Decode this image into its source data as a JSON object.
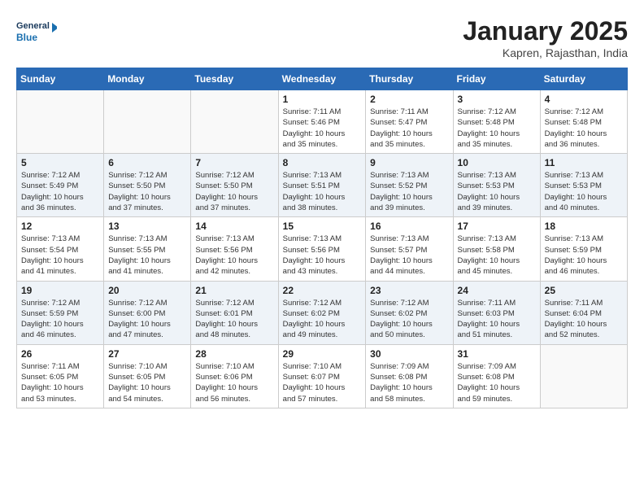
{
  "header": {
    "logo_line1": "General",
    "logo_line2": "Blue",
    "month": "January 2025",
    "location": "Kapren, Rajasthan, India"
  },
  "days_of_week": [
    "Sunday",
    "Monday",
    "Tuesday",
    "Wednesday",
    "Thursday",
    "Friday",
    "Saturday"
  ],
  "weeks": [
    [
      {
        "day": "",
        "info": ""
      },
      {
        "day": "",
        "info": ""
      },
      {
        "day": "",
        "info": ""
      },
      {
        "day": "1",
        "info": "Sunrise: 7:11 AM\nSunset: 5:46 PM\nDaylight: 10 hours\nand 35 minutes."
      },
      {
        "day": "2",
        "info": "Sunrise: 7:11 AM\nSunset: 5:47 PM\nDaylight: 10 hours\nand 35 minutes."
      },
      {
        "day": "3",
        "info": "Sunrise: 7:12 AM\nSunset: 5:48 PM\nDaylight: 10 hours\nand 35 minutes."
      },
      {
        "day": "4",
        "info": "Sunrise: 7:12 AM\nSunset: 5:48 PM\nDaylight: 10 hours\nand 36 minutes."
      }
    ],
    [
      {
        "day": "5",
        "info": "Sunrise: 7:12 AM\nSunset: 5:49 PM\nDaylight: 10 hours\nand 36 minutes."
      },
      {
        "day": "6",
        "info": "Sunrise: 7:12 AM\nSunset: 5:50 PM\nDaylight: 10 hours\nand 37 minutes."
      },
      {
        "day": "7",
        "info": "Sunrise: 7:12 AM\nSunset: 5:50 PM\nDaylight: 10 hours\nand 37 minutes."
      },
      {
        "day": "8",
        "info": "Sunrise: 7:13 AM\nSunset: 5:51 PM\nDaylight: 10 hours\nand 38 minutes."
      },
      {
        "day": "9",
        "info": "Sunrise: 7:13 AM\nSunset: 5:52 PM\nDaylight: 10 hours\nand 39 minutes."
      },
      {
        "day": "10",
        "info": "Sunrise: 7:13 AM\nSunset: 5:53 PM\nDaylight: 10 hours\nand 39 minutes."
      },
      {
        "day": "11",
        "info": "Sunrise: 7:13 AM\nSunset: 5:53 PM\nDaylight: 10 hours\nand 40 minutes."
      }
    ],
    [
      {
        "day": "12",
        "info": "Sunrise: 7:13 AM\nSunset: 5:54 PM\nDaylight: 10 hours\nand 41 minutes."
      },
      {
        "day": "13",
        "info": "Sunrise: 7:13 AM\nSunset: 5:55 PM\nDaylight: 10 hours\nand 41 minutes."
      },
      {
        "day": "14",
        "info": "Sunrise: 7:13 AM\nSunset: 5:56 PM\nDaylight: 10 hours\nand 42 minutes."
      },
      {
        "day": "15",
        "info": "Sunrise: 7:13 AM\nSunset: 5:56 PM\nDaylight: 10 hours\nand 43 minutes."
      },
      {
        "day": "16",
        "info": "Sunrise: 7:13 AM\nSunset: 5:57 PM\nDaylight: 10 hours\nand 44 minutes."
      },
      {
        "day": "17",
        "info": "Sunrise: 7:13 AM\nSunset: 5:58 PM\nDaylight: 10 hours\nand 45 minutes."
      },
      {
        "day": "18",
        "info": "Sunrise: 7:13 AM\nSunset: 5:59 PM\nDaylight: 10 hours\nand 46 minutes."
      }
    ],
    [
      {
        "day": "19",
        "info": "Sunrise: 7:12 AM\nSunset: 5:59 PM\nDaylight: 10 hours\nand 46 minutes."
      },
      {
        "day": "20",
        "info": "Sunrise: 7:12 AM\nSunset: 6:00 PM\nDaylight: 10 hours\nand 47 minutes."
      },
      {
        "day": "21",
        "info": "Sunrise: 7:12 AM\nSunset: 6:01 PM\nDaylight: 10 hours\nand 48 minutes."
      },
      {
        "day": "22",
        "info": "Sunrise: 7:12 AM\nSunset: 6:02 PM\nDaylight: 10 hours\nand 49 minutes."
      },
      {
        "day": "23",
        "info": "Sunrise: 7:12 AM\nSunset: 6:02 PM\nDaylight: 10 hours\nand 50 minutes."
      },
      {
        "day": "24",
        "info": "Sunrise: 7:11 AM\nSunset: 6:03 PM\nDaylight: 10 hours\nand 51 minutes."
      },
      {
        "day": "25",
        "info": "Sunrise: 7:11 AM\nSunset: 6:04 PM\nDaylight: 10 hours\nand 52 minutes."
      }
    ],
    [
      {
        "day": "26",
        "info": "Sunrise: 7:11 AM\nSunset: 6:05 PM\nDaylight: 10 hours\nand 53 minutes."
      },
      {
        "day": "27",
        "info": "Sunrise: 7:10 AM\nSunset: 6:05 PM\nDaylight: 10 hours\nand 54 minutes."
      },
      {
        "day": "28",
        "info": "Sunrise: 7:10 AM\nSunset: 6:06 PM\nDaylight: 10 hours\nand 56 minutes."
      },
      {
        "day": "29",
        "info": "Sunrise: 7:10 AM\nSunset: 6:07 PM\nDaylight: 10 hours\nand 57 minutes."
      },
      {
        "day": "30",
        "info": "Sunrise: 7:09 AM\nSunset: 6:08 PM\nDaylight: 10 hours\nand 58 minutes."
      },
      {
        "day": "31",
        "info": "Sunrise: 7:09 AM\nSunset: 6:08 PM\nDaylight: 10 hours\nand 59 minutes."
      },
      {
        "day": "",
        "info": ""
      }
    ]
  ]
}
